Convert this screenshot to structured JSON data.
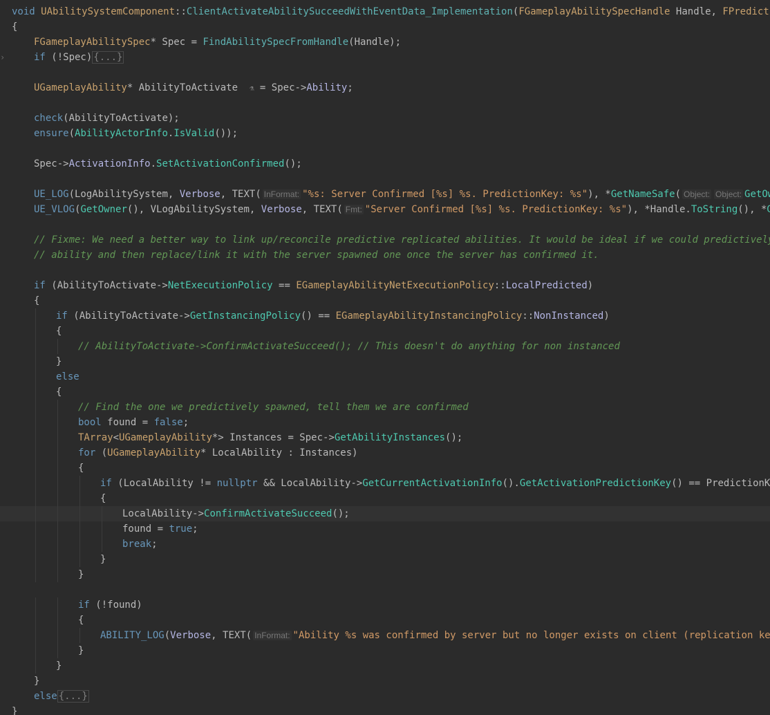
{
  "editor": {
    "lines": [
      {
        "indent": 0,
        "fold": "",
        "tokens": [
          [
            "kw",
            "void"
          ],
          [
            "plain",
            " "
          ],
          [
            "cls",
            "UAbilitySystemComponent"
          ],
          [
            "plain",
            "::"
          ],
          [
            "fn",
            "ClientActivateAbilitySucceedWithEventData_Implementation"
          ],
          [
            "plain",
            "("
          ],
          [
            "cls",
            "FGameplayAbilitySpecHandle"
          ],
          [
            "plain",
            " Handle, "
          ],
          [
            "cls",
            "FPredictionKey"
          ],
          [
            "plain",
            " "
          ]
        ]
      },
      {
        "indent": 0,
        "fold": "",
        "tokens": [
          [
            "plain",
            "{"
          ]
        ]
      },
      {
        "indent": 1,
        "fold": "",
        "tokens": [
          [
            "cls",
            "FGameplayAbilitySpec"
          ],
          [
            "plain",
            "* Spec = "
          ],
          [
            "fn",
            "FindAbilitySpecFromHandle"
          ],
          [
            "plain",
            "(Handle);"
          ]
        ]
      },
      {
        "indent": 1,
        "fold": ">",
        "tokens": [
          [
            "kw",
            "if"
          ],
          [
            "plain",
            " (!Spec)"
          ],
          [
            "folded",
            "{...}"
          ]
        ]
      },
      {
        "indent": 0,
        "fold": "",
        "tokens": []
      },
      {
        "indent": 1,
        "fold": "",
        "tokens": [
          [
            "cls",
            "UGameplayAbility"
          ],
          [
            "plain",
            "* AbilityToActivate  "
          ],
          [
            "inlay-icon",
            "⚗"
          ],
          [
            "plain",
            " = Spec->"
          ],
          [
            "member",
            "Ability"
          ],
          [
            "plain",
            ";"
          ]
        ]
      },
      {
        "indent": 0,
        "fold": "",
        "tokens": []
      },
      {
        "indent": 1,
        "fold": "",
        "tokens": [
          [
            "mac",
            "check"
          ],
          [
            "plain",
            "(AbilityToActivate);"
          ]
        ]
      },
      {
        "indent": 1,
        "fold": "",
        "tokens": [
          [
            "mac",
            "ensure"
          ],
          [
            "plain",
            "("
          ],
          [
            "memfn",
            "AbilityActorInfo"
          ],
          [
            "plain",
            "."
          ],
          [
            "memfn",
            "IsValid"
          ],
          [
            "plain",
            "());"
          ]
        ]
      },
      {
        "indent": 0,
        "fold": "",
        "tokens": []
      },
      {
        "indent": 1,
        "fold": "",
        "tokens": [
          [
            "plain",
            "Spec->"
          ],
          [
            "member",
            "ActivationInfo"
          ],
          [
            "plain",
            "."
          ],
          [
            "memfn",
            "SetActivationConfirmed"
          ],
          [
            "plain",
            "();"
          ]
        ]
      },
      {
        "indent": 0,
        "fold": "",
        "tokens": []
      },
      {
        "indent": 1,
        "fold": "",
        "tokens": [
          [
            "mac",
            "UE_LOG"
          ],
          [
            "plain",
            "(LogAbilitySystem, "
          ],
          [
            "member",
            "Verbose"
          ],
          [
            "plain",
            ", TEXT("
          ],
          [
            "hint",
            "InFormat:"
          ],
          [
            "str",
            "\"%s: Server Confirmed [%s] %s. PredictionKey: %s\""
          ],
          [
            "plain",
            "), *"
          ],
          [
            "memfn",
            "GetNameSafe"
          ],
          [
            "plain",
            "("
          ],
          [
            "hint",
            "Object:"
          ],
          [
            "hint",
            "Object:"
          ],
          [
            "memfn",
            "GetOwner"
          ],
          [
            "plain",
            "("
          ]
        ]
      },
      {
        "indent": 1,
        "fold": "",
        "tokens": [
          [
            "mac",
            "UE_VLOG"
          ],
          [
            "plain",
            "("
          ],
          [
            "memfn",
            "GetOwner"
          ],
          [
            "plain",
            "(), VLogAbilitySystem, "
          ],
          [
            "member",
            "Verbose"
          ],
          [
            "plain",
            ", TEXT("
          ],
          [
            "hint",
            "Fmt:"
          ],
          [
            "str",
            "\"Server Confirmed [%s] %s. PredictionKey: %s\""
          ],
          [
            "plain",
            "), *Handle."
          ],
          [
            "memfn",
            "ToString"
          ],
          [
            "plain",
            "(), *"
          ],
          [
            "memfn",
            "GetName"
          ]
        ]
      },
      {
        "indent": 0,
        "fold": "",
        "tokens": []
      },
      {
        "indent": 1,
        "fold": "",
        "tokens": [
          [
            "cmt",
            "// Fixme: We need a better way to link up/reconcile predictive replicated abilities. It would be ideal if we could predictively spawn"
          ]
        ]
      },
      {
        "indent": 1,
        "fold": "",
        "tokens": [
          [
            "cmt",
            "// ability and then replace/link it with the server spawned one once the server has confirmed it."
          ]
        ]
      },
      {
        "indent": 0,
        "fold": "",
        "tokens": []
      },
      {
        "indent": 1,
        "fold": "",
        "tokens": [
          [
            "kw",
            "if"
          ],
          [
            "plain",
            " (AbilityToActivate->"
          ],
          [
            "memfn",
            "NetExecutionPolicy"
          ],
          [
            "plain",
            " == "
          ],
          [
            "cls",
            "EGameplayAbilityNetExecutionPolicy"
          ],
          [
            "plain",
            "::"
          ],
          [
            "member",
            "LocalPredicted"
          ],
          [
            "plain",
            ")"
          ]
        ]
      },
      {
        "indent": 1,
        "fold": "",
        "tokens": [
          [
            "plain",
            "{"
          ]
        ]
      },
      {
        "indent": 2,
        "fold": "",
        "tokens": [
          [
            "kw",
            "if"
          ],
          [
            "plain",
            " (AbilityToActivate->"
          ],
          [
            "memfn",
            "GetInstancingPolicy"
          ],
          [
            "plain",
            "() == "
          ],
          [
            "cls",
            "EGameplayAbilityInstancingPolicy"
          ],
          [
            "plain",
            "::"
          ],
          [
            "member",
            "NonInstanced"
          ],
          [
            "plain",
            ")"
          ]
        ]
      },
      {
        "indent": 2,
        "fold": "",
        "tokens": [
          [
            "plain",
            "{"
          ]
        ]
      },
      {
        "indent": 3,
        "fold": "",
        "tokens": [
          [
            "cmt",
            "// AbilityToActivate->ConfirmActivateSucceed(); // This doesn't do anything for non instanced"
          ]
        ]
      },
      {
        "indent": 2,
        "fold": "",
        "tokens": [
          [
            "plain",
            "}"
          ]
        ]
      },
      {
        "indent": 2,
        "fold": "",
        "tokens": [
          [
            "kw",
            "else"
          ]
        ]
      },
      {
        "indent": 2,
        "fold": "",
        "tokens": [
          [
            "plain",
            "{"
          ]
        ]
      },
      {
        "indent": 3,
        "fold": "",
        "tokens": [
          [
            "cmt",
            "// Find the one we predictively spawned, tell them we are confirmed"
          ]
        ]
      },
      {
        "indent": 3,
        "fold": "",
        "tokens": [
          [
            "kw",
            "bool"
          ],
          [
            "plain",
            " found = "
          ],
          [
            "kw",
            "false"
          ],
          [
            "plain",
            ";"
          ]
        ]
      },
      {
        "indent": 3,
        "fold": "",
        "tokens": [
          [
            "cls",
            "TArray"
          ],
          [
            "plain",
            "<"
          ],
          [
            "cls",
            "UGameplayAbility"
          ],
          [
            "plain",
            "*> Instances = Spec->"
          ],
          [
            "memfn",
            "GetAbilityInstances"
          ],
          [
            "plain",
            "();"
          ]
        ]
      },
      {
        "indent": 3,
        "fold": "",
        "tokens": [
          [
            "kw",
            "for"
          ],
          [
            "plain",
            " ("
          ],
          [
            "cls",
            "UGameplayAbility"
          ],
          [
            "plain",
            "* LocalAbility : Instances)"
          ]
        ]
      },
      {
        "indent": 3,
        "fold": "",
        "tokens": [
          [
            "plain",
            "{"
          ]
        ]
      },
      {
        "indent": 4,
        "fold": "",
        "tokens": [
          [
            "kw",
            "if"
          ],
          [
            "plain",
            " (LocalAbility != "
          ],
          [
            "kw",
            "nullptr"
          ],
          [
            "plain",
            " && LocalAbility->"
          ],
          [
            "memfn",
            "GetCurrentActivationInfo"
          ],
          [
            "plain",
            "()."
          ],
          [
            "memfn",
            "GetActivationPredictionKey"
          ],
          [
            "plain",
            "() == PredictionKey)"
          ]
        ]
      },
      {
        "indent": 4,
        "fold": "",
        "tokens": [
          [
            "plain",
            "{"
          ]
        ]
      },
      {
        "indent": 5,
        "fold": "",
        "current": true,
        "tokens": [
          [
            "plain",
            "LocalAbility->"
          ],
          [
            "memfn",
            "ConfirmActivateSucceed"
          ],
          [
            "plain",
            "();"
          ]
        ]
      },
      {
        "indent": 5,
        "fold": "",
        "tokens": [
          [
            "plain",
            "found = "
          ],
          [
            "kw",
            "true"
          ],
          [
            "plain",
            ";"
          ]
        ]
      },
      {
        "indent": 5,
        "fold": "",
        "tokens": [
          [
            "kw",
            "break"
          ],
          [
            "plain",
            ";"
          ]
        ]
      },
      {
        "indent": 4,
        "fold": "",
        "tokens": [
          [
            "plain",
            "}"
          ]
        ]
      },
      {
        "indent": 3,
        "fold": "",
        "tokens": [
          [
            "plain",
            "}"
          ]
        ]
      },
      {
        "indent": 0,
        "fold": "",
        "tokens": []
      },
      {
        "indent": 3,
        "fold": "",
        "tokens": [
          [
            "kw",
            "if"
          ],
          [
            "plain",
            " (!found)"
          ]
        ]
      },
      {
        "indent": 3,
        "fold": "",
        "tokens": [
          [
            "plain",
            "{"
          ]
        ]
      },
      {
        "indent": 4,
        "fold": "",
        "tokens": [
          [
            "mac",
            "ABILITY_LOG"
          ],
          [
            "plain",
            "("
          ],
          [
            "member",
            "Verbose"
          ],
          [
            "plain",
            ", TEXT("
          ],
          [
            "hint",
            "InFormat:"
          ],
          [
            "str",
            "\"Ability %s was confirmed by server but no longer exists on client (replication key: %d"
          ]
        ]
      },
      {
        "indent": 3,
        "fold": "",
        "tokens": [
          [
            "plain",
            "}"
          ]
        ]
      },
      {
        "indent": 2,
        "fold": "",
        "tokens": [
          [
            "plain",
            "}"
          ]
        ]
      },
      {
        "indent": 1,
        "fold": "",
        "tokens": [
          [
            "plain",
            "}"
          ]
        ]
      },
      {
        "indent": 1,
        "fold": "",
        "tokens": [
          [
            "kw",
            "else"
          ],
          [
            "folded",
            "{...}"
          ]
        ]
      },
      {
        "indent": 0,
        "fold": "",
        "tokens": [
          [
            "plain",
            "}"
          ]
        ]
      }
    ]
  }
}
